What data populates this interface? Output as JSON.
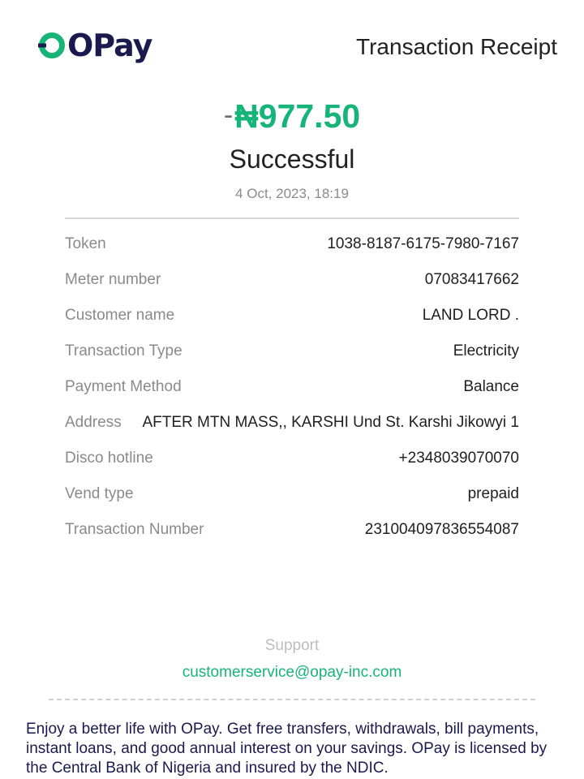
{
  "brand": {
    "name": "OPay",
    "logo_icon": "opay-o-icon",
    "colors": {
      "accent": "#17b47a",
      "navy": "#1b1a4f"
    }
  },
  "header": {
    "title": "Transaction Receipt"
  },
  "summary": {
    "amount_sign": "-",
    "amount": "₦977.50",
    "status": "Successful",
    "datetime": "4 Oct, 2023, 18:19"
  },
  "details": [
    {
      "label": "Token",
      "value": "1038-8187-6175-7980-7167"
    },
    {
      "label": "Meter number",
      "value": "07083417662"
    },
    {
      "label": "Customer name",
      "value": "LAND LORD ."
    },
    {
      "label": "Transaction Type",
      "value": "Electricity"
    },
    {
      "label": "Payment Method",
      "value": "Balance"
    },
    {
      "label": "Address",
      "value": "AFTER MTN MASS,, KARSHI Und St. Karshi Jikowyi 1"
    },
    {
      "label": "Disco hotline",
      "value": "+2348039070070"
    },
    {
      "label": "Vend type",
      "value": "prepaid"
    },
    {
      "label": "Transaction Number",
      "value": "231004097836554087"
    }
  ],
  "support": {
    "label": "Support",
    "email": "customerservice@opay-inc.com"
  },
  "footer": {
    "text": "Enjoy a better life with OPay. Get free transfers, withdrawals, bill payments, instant loans, and good annual interest on your savings. OPay is licensed by the Central Bank of Nigeria and insured by the NDIC."
  }
}
